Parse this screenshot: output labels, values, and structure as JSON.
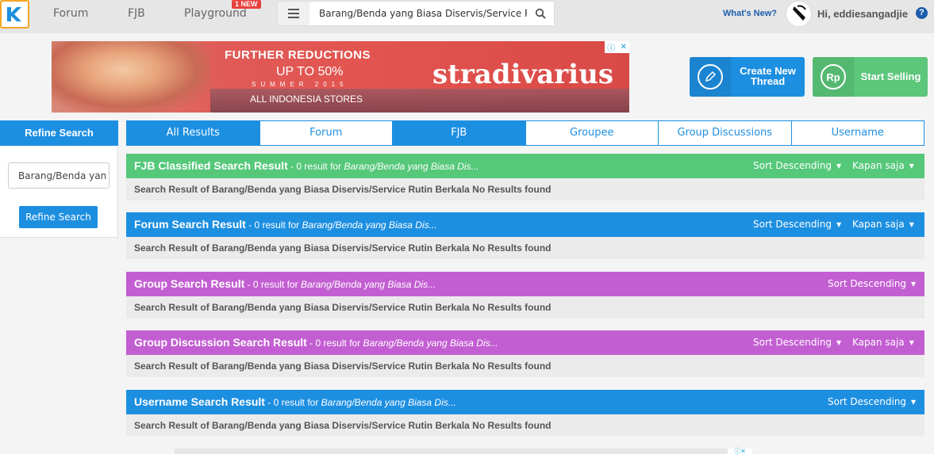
{
  "header": {
    "nav": [
      "Forum",
      "FJB",
      "Playground"
    ],
    "new_badge": "1 NEW",
    "search_value": "Barang/Benda yang Biasa Diservis/Service Ru",
    "whats_new": "What's New?",
    "greeting": "Hi, eddiesangadjie",
    "help": "?"
  },
  "ad": {
    "line1": "FURTHER REDUCTIONS",
    "line2": "UP TO 50%",
    "line3": "SUMMER 2015",
    "line4": "ALL INDONESIA STORES",
    "brand": "stradivarius"
  },
  "cta": {
    "create_line1": "Create New",
    "create_line2": "Thread",
    "sell": "Start Selling",
    "sell_icon_text": "Rp"
  },
  "refine": {
    "title": "Refine Search",
    "input_value": "Barang/Benda yan",
    "button": "Refine Search"
  },
  "tabs": [
    "All Results",
    "Forum",
    "FJB",
    "Groupee",
    "Group Discussions",
    "Username"
  ],
  "sort_label": "Sort Descending",
  "time_label": "Kapan saja",
  "sections": [
    {
      "title": "FJB Classified Search Result",
      "meta": " - 0 result for ",
      "query": "Barang/Benda yang Biasa Dis...",
      "body": "Search Result of Barang/Benda yang Biasa Diservis/Service Rutin Berkala No Results found"
    },
    {
      "title": "Forum Search Result",
      "meta": " - 0 result for ",
      "query": "Barang/Benda yang Biasa Dis...",
      "body": "Search Result of Barang/Benda yang Biasa Diservis/Service Rutin Berkala No Results found"
    },
    {
      "title": "Group Search Result",
      "meta": " - 0 result for ",
      "query": "Barang/Benda yang Biasa Dis...",
      "body": "Search Result of Barang/Benda yang Biasa Diservis/Service Rutin Berkala No Results found"
    },
    {
      "title": "Group Discussion Search Result",
      "meta": " - 0 result for ",
      "query": "Barang/Benda yang Biasa Dis...",
      "body": "Search Result of Barang/Benda yang Biasa Diservis/Service Rutin Berkala No Results found"
    },
    {
      "title": "Username Search Result",
      "meta": " - 0 result for ",
      "query": "Barang/Benda yang Biasa Dis...",
      "body": "Search Result of Barang/Benda yang Biasa Diservis/Service Rutin Berkala No Results found"
    }
  ],
  "colors": {
    "blue": "#1d8fe1",
    "green": "#55c87a",
    "purple": "#c35ed2",
    "badge": "#e8413c"
  }
}
